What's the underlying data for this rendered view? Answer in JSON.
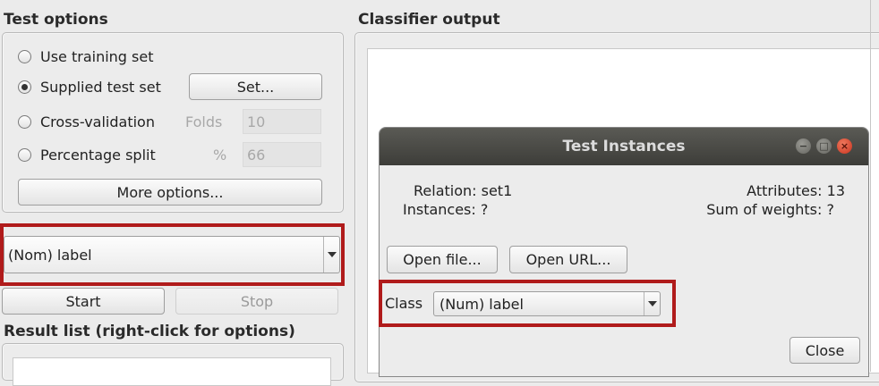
{
  "test_options": {
    "title": "Test options",
    "use_training_set": "Use training set",
    "supplied_test_set": "Supplied test set",
    "set_button": "Set...",
    "cross_validation": "Cross-validation",
    "folds_label": "Folds",
    "folds_value": "10",
    "percentage_split": "Percentage split",
    "percent_label": "%",
    "percent_value": "66",
    "more_options": "More options...",
    "selected_option": "Supplied test set"
  },
  "class_combo": {
    "value": "(Nom) label"
  },
  "actions": {
    "start": "Start",
    "stop": "Stop"
  },
  "result_list": {
    "title": "Result list (right-click for options)"
  },
  "classifier_output": {
    "title": "Classifier output"
  },
  "dialog": {
    "title": "Test Instances",
    "relation_label": "Relation:",
    "relation_value": "set1",
    "instances_label": "Instances:",
    "instances_value": "?",
    "attributes_label": "Attributes:",
    "attributes_value": "13",
    "sum_weights_label": "Sum of weights:",
    "sum_weights_value": "?",
    "open_file": "Open file...",
    "open_url": "Open URL...",
    "class_label": "Class",
    "class_value": "(Num) label",
    "close": "Close"
  },
  "colors": {
    "highlight": "#b01b1b",
    "titlebar": "#3d3d39",
    "close_button": "#d23a2a"
  },
  "icons": [
    "minimize-icon",
    "maximize-icon",
    "close-icon",
    "chevron-down-icon",
    "radio-icon"
  ]
}
